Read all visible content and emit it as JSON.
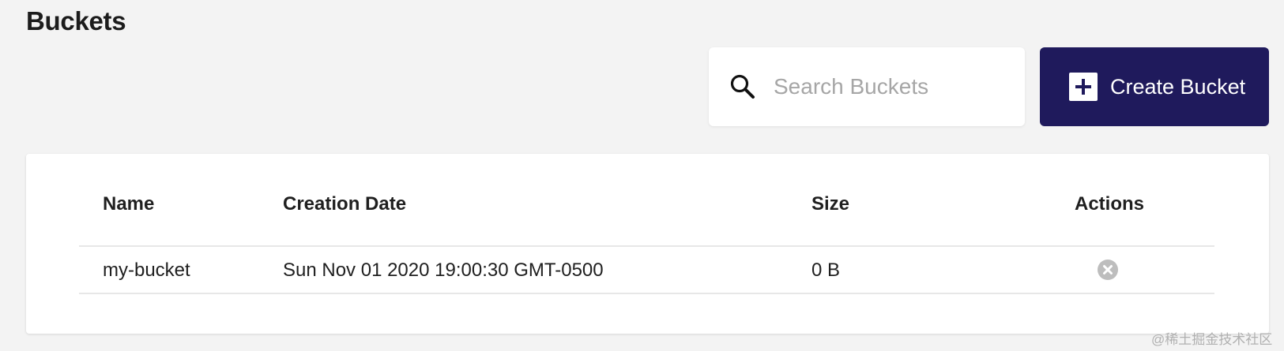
{
  "header": {
    "title": "Buckets"
  },
  "search": {
    "placeholder": "Search Buckets",
    "value": "",
    "icon": "search-icon"
  },
  "create_button": {
    "label": "Create Bucket",
    "icon": "plus-icon",
    "color": "#1f1a5c"
  },
  "table": {
    "columns": [
      "Name",
      "Creation Date",
      "Size",
      "Actions"
    ],
    "rows": [
      {
        "name": "my-bucket",
        "creation_date": "Sun Nov 01 2020 19:00:30 GMT-0500",
        "size": "0 B",
        "action_icon": "delete-icon"
      }
    ]
  },
  "watermark": "@稀土掘金技术社区"
}
